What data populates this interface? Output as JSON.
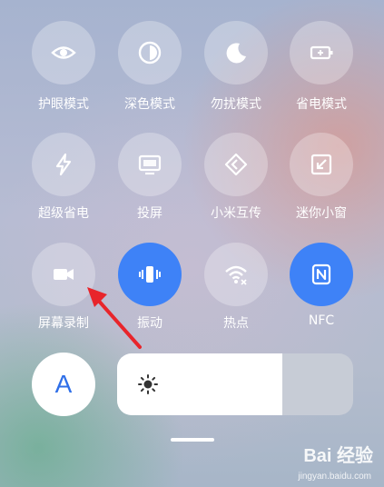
{
  "tiles": [
    {
      "label": "护眼模式",
      "icon": "eye-icon",
      "active": false
    },
    {
      "label": "深色模式",
      "icon": "contrast-icon",
      "active": false
    },
    {
      "label": "勿扰模式",
      "icon": "moon-icon",
      "active": false
    },
    {
      "label": "省电模式",
      "icon": "battery-icon",
      "active": false
    },
    {
      "label": "超级省电",
      "icon": "lightning-icon",
      "active": false
    },
    {
      "label": "投屏",
      "icon": "screen-cast-icon",
      "active": false
    },
    {
      "label": "小米互传",
      "icon": "mi-share-icon",
      "active": false
    },
    {
      "label": "迷你小窗",
      "icon": "mini-window-icon",
      "active": false
    },
    {
      "label": "屏幕录制",
      "icon": "video-camera-icon",
      "active": false
    },
    {
      "label": "振动",
      "icon": "vibrate-icon",
      "active": true
    },
    {
      "label": "热点",
      "icon": "hotspot-icon",
      "active": false
    },
    {
      "label": "NFC",
      "icon": "nfc-icon",
      "active": true
    }
  ],
  "auto_brightness": {
    "label": "A",
    "icon": "auto-brightness-icon"
  },
  "brightness": {
    "level": 0.7,
    "icon": "sun-icon"
  },
  "colors": {
    "accent": "#3e82f7",
    "annotation": "#e8252b"
  },
  "watermark": {
    "brand": "Bai 经验",
    "url": "jingyan.baidu.com"
  }
}
